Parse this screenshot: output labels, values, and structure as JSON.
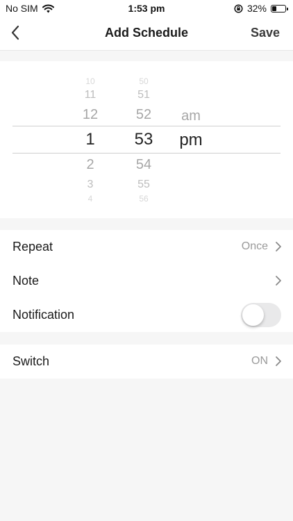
{
  "status": {
    "carrier": "No SIM",
    "time": "1:53 pm",
    "battery": "32%",
    "battery_level": 0.32
  },
  "nav": {
    "title": "Add Schedule",
    "save_label": "Save"
  },
  "picker": {
    "hours": [
      "10",
      "11",
      "12",
      "1",
      "2",
      "3",
      "4"
    ],
    "minutes": [
      "50",
      "51",
      "52",
      "53",
      "54",
      "55",
      "56"
    ],
    "ampm": [
      "am",
      "pm"
    ],
    "selected_hour": "1",
    "selected_minute": "53",
    "selected_ampm": "pm"
  },
  "settings": {
    "repeat": {
      "label": "Repeat",
      "value": "Once"
    },
    "note": {
      "label": "Note",
      "value": ""
    },
    "notification": {
      "label": "Notification",
      "enabled": false
    }
  },
  "switch_row": {
    "label": "Switch",
    "value": "ON"
  },
  "colors": {
    "background": "#f6f6f6",
    "toggle_off": "#e9e9ea",
    "muted_text": "#9a9a9a"
  }
}
